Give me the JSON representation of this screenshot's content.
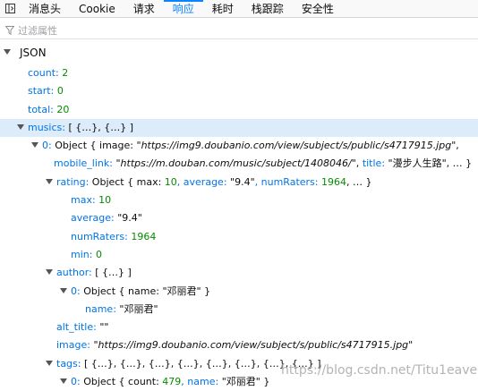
{
  "tabs": [
    "消息头",
    "Cookie",
    "请求",
    "响应",
    "耗时",
    "栈跟踪",
    "安全性"
  ],
  "active_tab": "响应",
  "filter": {
    "placeholder": "过滤属性"
  },
  "section": {
    "title": "JSON"
  },
  "accent_color": "#0a84ff",
  "rows": {
    "count": {
      "key": "count:",
      "value": "2"
    },
    "start": {
      "key": "start:",
      "value": "0"
    },
    "total": {
      "key": "total:",
      "value": "20"
    },
    "musics": {
      "key": "musics:",
      "summary": "[ {…}, {…} ]"
    },
    "m0": {
      "key": "0:",
      "obj_prefix": "Object { image:",
      "image_q1": "\"",
      "image_url": "https://img9.doubanio.com/view/subject/s/public/s4717915.jpg",
      "image_q2": "\",",
      "mobile_key": "mobile_link:",
      "mobile_q1": "\"",
      "mobile_url": "https://m.douban.com/music/subject/1408046/",
      "mobile_q2": "\",",
      "title_key": "title:",
      "title_val": "\"漫步人生路\"",
      "ellipsis": ", … }"
    },
    "rating": {
      "key": "rating:",
      "prefix": "Object { max:",
      "max": "10",
      "avg_key": ", average:",
      "avg": "\"9.4\"",
      "nr_key": ", numRaters:",
      "nr": "1964",
      "tail": ", … }"
    },
    "max": {
      "key": "max:",
      "value": "10"
    },
    "average": {
      "key": "average:",
      "value": "\"9.4\""
    },
    "numRaters": {
      "key": "numRaters:",
      "value": "1964"
    },
    "min": {
      "key": "min:",
      "value": "0"
    },
    "author": {
      "key": "author:",
      "summary": "[ {…} ]"
    },
    "a0": {
      "key": "0:",
      "prefix": "Object { name:",
      "name": "\"邓丽君\"",
      "tail": "}"
    },
    "aname": {
      "key": "name:",
      "value": "\"邓丽君\""
    },
    "alt_title": {
      "key": "alt_title:",
      "value": "\"\""
    },
    "image": {
      "key": "image:",
      "q1": "\"",
      "url": "https://img9.doubanio.com/view/subject/s/public/s4717915.jpg",
      "q2": "\""
    },
    "tags": {
      "key": "tags:",
      "summary": "[ {…}, {…}, {…}, {…}, {…}, {…}, {…}, {…} ]"
    },
    "t0": {
      "key": "0:",
      "prefix": "Object { count:",
      "count": "479",
      "name_key": ", name:",
      "name": "\"邓丽君\"",
      "tail": "}"
    }
  },
  "watermark": "https://blog.csdn.net/Titu1eave"
}
